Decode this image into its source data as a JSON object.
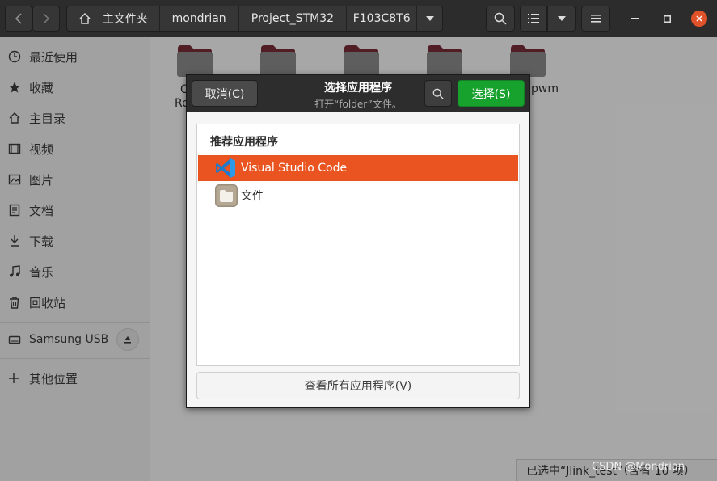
{
  "header": {
    "breadcrumbs": [
      "主文件夹",
      "mondrian",
      "Project_STM32",
      "F103C8T6"
    ]
  },
  "sidebar": {
    "items": [
      {
        "label": "最近使用",
        "icon": "clock-icon"
      },
      {
        "label": "收藏",
        "icon": "star-icon"
      },
      {
        "label": "主目录",
        "icon": "home-icon"
      },
      {
        "label": "视频",
        "icon": "film-icon"
      },
      {
        "label": "图片",
        "icon": "image-icon"
      },
      {
        "label": "文档",
        "icon": "document-icon"
      },
      {
        "label": "下载",
        "icon": "download-icon"
      },
      {
        "label": "音乐",
        "icon": "music-icon"
      },
      {
        "label": "回收站",
        "icon": "trash-icon"
      }
    ],
    "device": {
      "label": "Samsung USB",
      "icon": "drive-icon"
    },
    "other": {
      "label": "其他位置",
      "icon": "plus-icon"
    }
  },
  "main": {
    "folder_labels": [
      "C",
      "Re",
      "pwm"
    ]
  },
  "dialog": {
    "cancel_label": "取消(C)",
    "title": "选择应用程序",
    "subtitle": "打开“folder”文件。",
    "select_label": "选择(S)",
    "section_title": "推荐应用程序",
    "apps": [
      {
        "name": "Visual Studio Code",
        "icon": "vscode-icon",
        "selected": true
      },
      {
        "name": "文件",
        "icon": "files-app-icon",
        "selected": false
      }
    ],
    "view_all_label": "查看所有应用程序(V)"
  },
  "status": {
    "text": "已选中“Jlink_test”（含有 10 项）"
  },
  "watermark": "CSDN @Mondrian",
  "colors": {
    "accent": "#e95420",
    "select_button": "#17a12d",
    "header_bg": "#2c2c2c",
    "close_button": "#e0522a"
  }
}
